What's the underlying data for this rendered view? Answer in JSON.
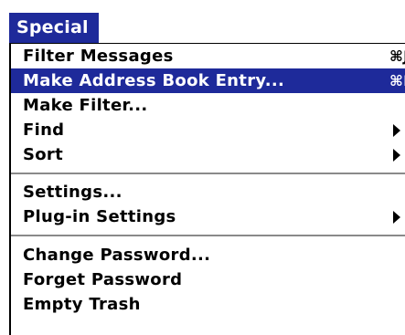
{
  "menu": {
    "title": "Special",
    "accent_color": "#1e2a9a",
    "items": [
      {
        "label": "Filter Messages",
        "shortcut": "⌘J",
        "submenu": false
      },
      {
        "label": "Make Address Book Entry...",
        "shortcut": "⌘K",
        "submenu": false,
        "highlighted": true
      },
      {
        "label": "Make Filter...",
        "shortcut": "",
        "submenu": false
      },
      {
        "label": "Find",
        "shortcut": "",
        "submenu": true,
        "submenu_icon": "triangle-right-icon"
      },
      {
        "label": "Sort",
        "shortcut": "",
        "submenu": true,
        "submenu_icon": "triangle-right-icon"
      },
      {
        "label": "Settings...",
        "shortcut": "",
        "submenu": false
      },
      {
        "label": "Plug-in Settings",
        "shortcut": "",
        "submenu": true,
        "submenu_icon": "triangle-right-icon"
      },
      {
        "label": "Change Password...",
        "shortcut": "",
        "submenu": false
      },
      {
        "label": "Forget Password",
        "shortcut": "",
        "submenu": false
      },
      {
        "label": "Empty Trash",
        "shortcut": "",
        "submenu": false
      }
    ]
  }
}
